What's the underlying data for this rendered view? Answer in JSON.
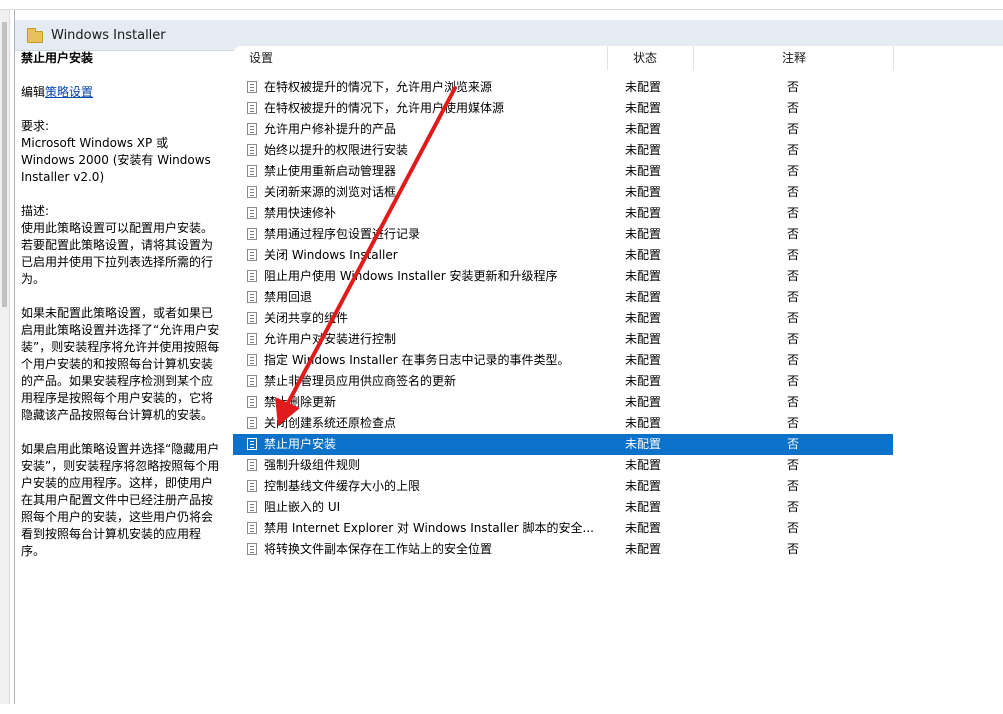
{
  "window": {
    "folder_title": "Windows Installer"
  },
  "description": {
    "title": "禁止用户安装",
    "edit_prefix": "编辑",
    "edit_link": "策略设置",
    "requirements_label": "要求:",
    "requirements_text": "Microsoft Windows XP 或 Windows 2000 (安装有 Windows Installer v2.0)",
    "desc_label": "描述:",
    "para1": "使用此策略设置可以配置用户安装。若要配置此策略设置，请将其设置为已启用并使用下拉列表选择所需的行为。",
    "para2": "如果未配置此策略设置，或者如果已启用此策略设置并选择了“允许用户安装”，则安装程序将允许并使用按照每个用户安装的和按照每台计算机安装的产品。如果安装程序检测到某个应用程序是按照每个用户安装的，它将隐藏该产品按照每台计算机的安装。",
    "para3": "如果启用此策略设置并选择“隐藏用户安装”，则安装程序将忽略按照每个用户安装的应用程序。这样，即使用户在其用户配置文件中已经注册产品按照每个用户的安装，这些用户仍将会看到按照每台计算机安装的应用程序。"
  },
  "columns": {
    "setting": "设置",
    "state": "状态",
    "note": "注释"
  },
  "rows": [
    {
      "name": "在特权被提升的情况下，允许用户浏览来源",
      "state": "未配置",
      "note": "否"
    },
    {
      "name": "在特权被提升的情况下，允许用户使用媒体源",
      "state": "未配置",
      "note": "否"
    },
    {
      "name": "允许用户修补提升的产品",
      "state": "未配置",
      "note": "否"
    },
    {
      "name": "始终以提升的权限进行安装",
      "state": "未配置",
      "note": "否"
    },
    {
      "name": "禁止使用重新启动管理器",
      "state": "未配置",
      "note": "否"
    },
    {
      "name": "关闭新来源的浏览对话框",
      "state": "未配置",
      "note": "否"
    },
    {
      "name": "禁用快速修补",
      "state": "未配置",
      "note": "否"
    },
    {
      "name": "禁用通过程序包设置进行记录",
      "state": "未配置",
      "note": "否"
    },
    {
      "name": "关闭 Windows Installer",
      "state": "未配置",
      "note": "否"
    },
    {
      "name": "阻止用户使用 Windows Installer 安装更新和升级程序",
      "state": "未配置",
      "note": "否"
    },
    {
      "name": "禁用回退",
      "state": "未配置",
      "note": "否"
    },
    {
      "name": "关闭共享的组件",
      "state": "未配置",
      "note": "否"
    },
    {
      "name": "允许用户对安装进行控制",
      "state": "未配置",
      "note": "否"
    },
    {
      "name": "指定 Windows Installer 在事务日志中记录的事件类型。",
      "state": "未配置",
      "note": "否"
    },
    {
      "name": "禁止非管理员应用供应商签名的更新",
      "state": "未配置",
      "note": "否"
    },
    {
      "name": "禁止删除更新",
      "state": "未配置",
      "note": "否"
    },
    {
      "name": "关闭创建系统还原检查点",
      "state": "未配置",
      "note": "否"
    },
    {
      "name": "禁止用户安装",
      "state": "未配置",
      "note": "否",
      "selected": true
    },
    {
      "name": "强制升级组件规则",
      "state": "未配置",
      "note": "否"
    },
    {
      "name": "控制基线文件缓存大小的上限",
      "state": "未配置",
      "note": "否"
    },
    {
      "name": "阻止嵌入的 UI",
      "state": "未配置",
      "note": "否"
    },
    {
      "name": "禁用 Internet Explorer 对 Windows Installer 脚本的安全...",
      "state": "未配置",
      "note": "否"
    },
    {
      "name": "将转换文件副本保存在工作站上的安全位置",
      "state": "未配置",
      "note": "否"
    }
  ],
  "colors": {
    "selection": "#0c72c9",
    "annotation_arrow": "#e01b1b",
    "header_bg": "#e4ebf3"
  }
}
